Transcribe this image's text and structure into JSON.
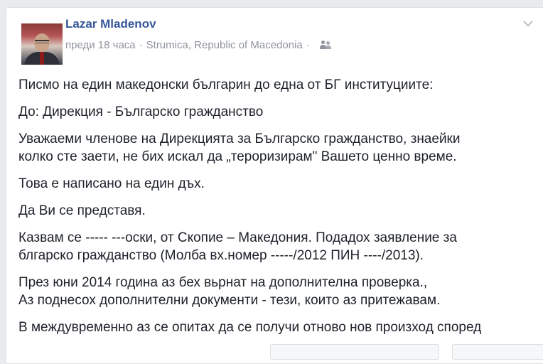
{
  "post": {
    "author": "Lazar Mladenov",
    "time": "преди 18 часа",
    "separator": "·",
    "location": "Strumica, Republic of Macedonia",
    "audience_icon": "friends-icon",
    "options_icon": "chevron-down-icon",
    "paragraphs": [
      [
        "Писмо на един македонски българин до една от БГ институциите:"
      ],
      [
        "До: Дирекция - Българско гражданство"
      ],
      [
        "Уважаеми членове на Дирекцията за Българско гражданство, знаейки",
        "колко сте заети, не бих искал да „тероризирам\" Вашето ценно време."
      ],
      [
        "Това е написано на един дъх."
      ],
      [
        "Да Ви се представя."
      ],
      [
        "Казвам се ----- ---оски, от Скопие – Македония. Подадох заявление за",
        "блгарско гражданство (Молба вх.номер -----/2012 ПИН ----/2013)."
      ],
      [
        "През юни 2014 година аз бех вьрнат на дополнителна проверка.,",
        "Аз поднесох дополнителни документи - тези, които аз притежавам."
      ],
      [
        "В междувременно аз се опитах да се получи отново нов произход според"
      ]
    ]
  },
  "colors": {
    "author_link": "#365899",
    "meta_text": "#90949c",
    "body_text": "#1d2129",
    "page_background": "#e9ebee"
  }
}
